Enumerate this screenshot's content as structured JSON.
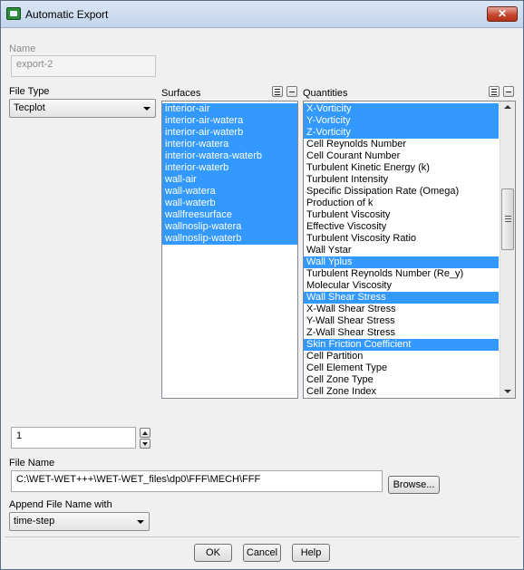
{
  "window": {
    "title": "Automatic Export",
    "close_glyph": "✕"
  },
  "name": {
    "label": "Name",
    "value": "export-2"
  },
  "file_type": {
    "label": "File Type",
    "selected": "Tecplot"
  },
  "surfaces": {
    "label": "Surfaces",
    "items": [
      {
        "text": "interior-air",
        "selected": true
      },
      {
        "text": "interior-air-watera",
        "selected": true
      },
      {
        "text": "interior-air-waterb",
        "selected": true
      },
      {
        "text": "interior-watera",
        "selected": true
      },
      {
        "text": "interior-watera-waterb",
        "selected": true
      },
      {
        "text": "interior-waterb",
        "selected": true
      },
      {
        "text": "wall-air",
        "selected": true
      },
      {
        "text": "wall-watera",
        "selected": true
      },
      {
        "text": "wall-waterb",
        "selected": true
      },
      {
        "text": "wallfreesurface",
        "selected": true
      },
      {
        "text": "wallnoslip-watera",
        "selected": true
      },
      {
        "text": "wallnoslip-waterb",
        "selected": true
      }
    ]
  },
  "quantities": {
    "label": "Quantities",
    "items": [
      {
        "text": "X-Vorticity",
        "selected": true
      },
      {
        "text": "Y-Vorticity",
        "selected": true
      },
      {
        "text": "Z-Vorticity",
        "selected": true
      },
      {
        "text": "Cell Reynolds Number",
        "selected": false
      },
      {
        "text": "Cell Courant Number",
        "selected": false
      },
      {
        "text": "Turbulent Kinetic Energy (k)",
        "selected": false
      },
      {
        "text": "Turbulent Intensity",
        "selected": false
      },
      {
        "text": "Specific Dissipation Rate (Omega)",
        "selected": false
      },
      {
        "text": "Production of k",
        "selected": false
      },
      {
        "text": "Turbulent Viscosity",
        "selected": false
      },
      {
        "text": "Effective Viscosity",
        "selected": false
      },
      {
        "text": "Turbulent Viscosity Ratio",
        "selected": false
      },
      {
        "text": "Wall Ystar",
        "selected": false
      },
      {
        "text": "Wall Yplus",
        "selected": true
      },
      {
        "text": "Turbulent Reynolds Number (Re_y)",
        "selected": false
      },
      {
        "text": "Molecular Viscosity",
        "selected": false
      },
      {
        "text": "Wall Shear Stress",
        "selected": true
      },
      {
        "text": "X-Wall Shear Stress",
        "selected": false
      },
      {
        "text": "Y-Wall Shear Stress",
        "selected": false
      },
      {
        "text": "Z-Wall Shear Stress",
        "selected": false
      },
      {
        "text": "Skin Friction Coefficient",
        "selected": true
      },
      {
        "text": "Cell Partition",
        "selected": false
      },
      {
        "text": "Cell Element Type",
        "selected": false
      },
      {
        "text": "Cell Zone Type",
        "selected": false
      },
      {
        "text": "Cell Zone Index",
        "selected": false
      }
    ]
  },
  "frequency": {
    "value": "1"
  },
  "file_name": {
    "label": "File Name",
    "value": "C:\\WET-WET+++\\WET-WET_files\\dp0\\FFF\\MECH\\FFF",
    "browse_label": "Browse..."
  },
  "append": {
    "label": "Append File Name with",
    "selected": "time-step"
  },
  "buttons": {
    "ok": "OK",
    "cancel": "Cancel",
    "help": "Help"
  },
  "colors": {
    "selection": "#3399ff"
  }
}
